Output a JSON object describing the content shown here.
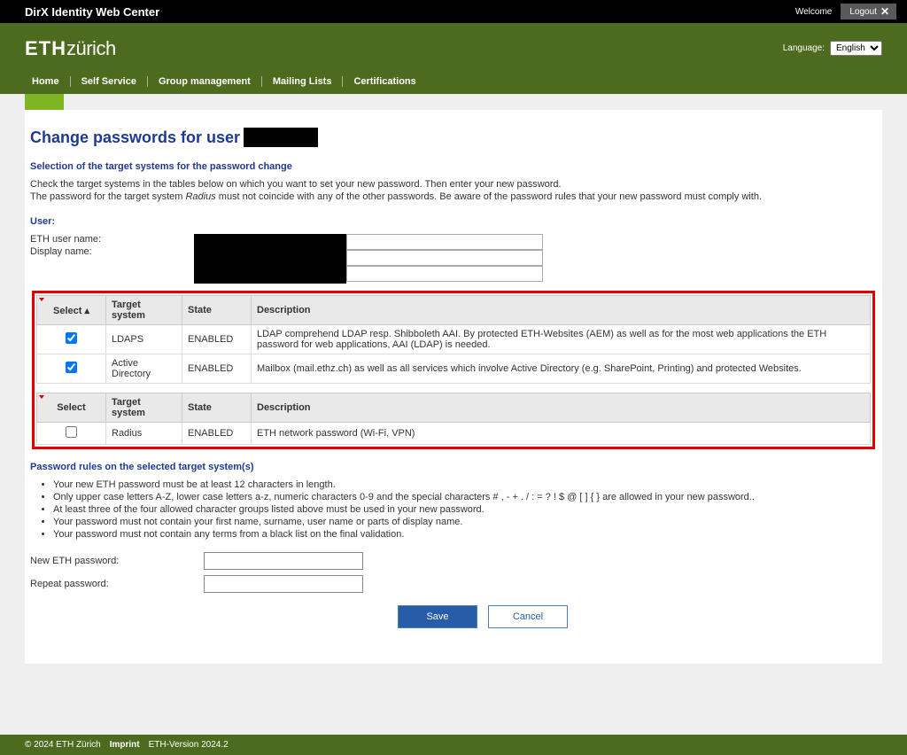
{
  "topbar": {
    "title": "DirX Identity Web Center",
    "welcome": "Welcome",
    "logout": "Logout"
  },
  "header": {
    "logo_bold": "ETH",
    "logo_rest": "zürich",
    "language_label": "Language:",
    "language_value": "English"
  },
  "nav": {
    "home": "Home",
    "self_service": "Self Service",
    "group_management": "Group management",
    "mailing_lists": "Mailing Lists",
    "certifications": "Certifications"
  },
  "page": {
    "title_prefix": "Change passwords for user",
    "section1": "Selection of the target systems for the password change",
    "para1": "Check the target systems in the tables below on which you want to set your new password. Then enter your new password.",
    "para2_a": "The password for the target system ",
    "para2_em": "Radius",
    "para2_b": " must not coincide with any of the other passwords. Be aware of the password rules that your new password must comply with."
  },
  "user": {
    "heading": "User:",
    "eth_user_name": "ETH user name:",
    "display_name": "Display name:"
  },
  "tables": {
    "cols": {
      "select": "Select",
      "select_sort": "Select ▴",
      "target": "Target system",
      "state": "State",
      "desc": "Description"
    },
    "t1": [
      {
        "checked": true,
        "target": "LDAPS",
        "state": "ENABLED",
        "desc": "LDAP comprehend LDAP resp. Shibboleth AAI. By protected ETH-Websites (AEM) as well as for the most web applications the ETH password for web applications, AAI (LDAP) is needed."
      },
      {
        "checked": true,
        "target": "Active Directory",
        "state": "ENABLED",
        "desc": "Mailbox (mail.ethz.ch) as well as all services which involve Active Directory (e.g. SharePoint, Printing) and protected Websites."
      }
    ],
    "t2": [
      {
        "checked": false,
        "target": "Radius",
        "state": "ENABLED",
        "desc": "ETH network password (Wi-Fi, VPN)"
      }
    ]
  },
  "rules": {
    "heading": "Password rules on the selected target system(s)",
    "items": [
      "Your new ETH password must be at least 12 characters in length.",
      "Only upper case letters A-Z, lower case letters a-z, numeric characters 0-9 and the special characters # , - + . / : = ? ! $ @ [ ] { } are allowed in your new password..",
      "At least three of the four allowed character groups listed above must be used in your new password.",
      "Your password must not contain your first name, surname, user name or parts of display name.",
      "Your password must not contain any terms from a black list on the final validation."
    ]
  },
  "pw": {
    "new": "New ETH password:",
    "repeat": "Repeat password:"
  },
  "buttons": {
    "save": "Save",
    "cancel": "Cancel"
  },
  "footer": {
    "copyright": "© 2024 ETH Zürich",
    "imprint": "Imprint",
    "version": "ETH-Version 2024.2"
  }
}
